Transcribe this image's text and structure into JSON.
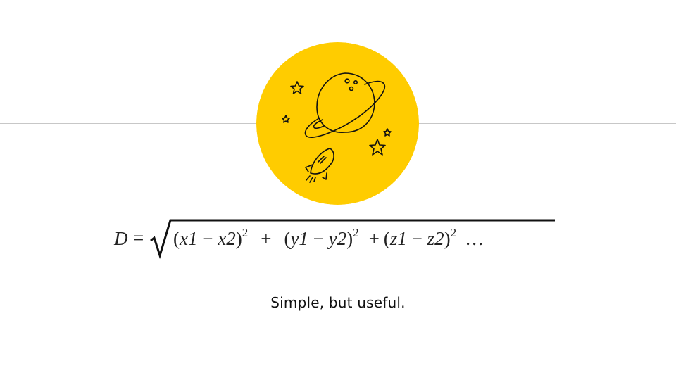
{
  "slide": {
    "formula": {
      "lhs": "D",
      "equals": "=",
      "terms": [
        {
          "open": "(",
          "a": "x1",
          "minus": " − ",
          "b": "x2",
          "close": ")",
          "exp": "2"
        },
        {
          "open": "(",
          "a": "y1",
          "minus": " − ",
          "b": "y2",
          "close": ")",
          "exp": "2"
        },
        {
          "open": "(",
          "a": "z1",
          "minus": " − ",
          "b": "z2",
          "close": ")",
          "exp": "2"
        }
      ],
      "plus": "+",
      "ellipsis": "…"
    },
    "caption": "Simple, but useful.",
    "illustration": {
      "icons": [
        "planet-icon",
        "rocket-icon",
        "star-icon"
      ],
      "circle_color": "#FFCC00",
      "line_color": "#111111"
    },
    "divider_color": "#C7C7C7"
  }
}
